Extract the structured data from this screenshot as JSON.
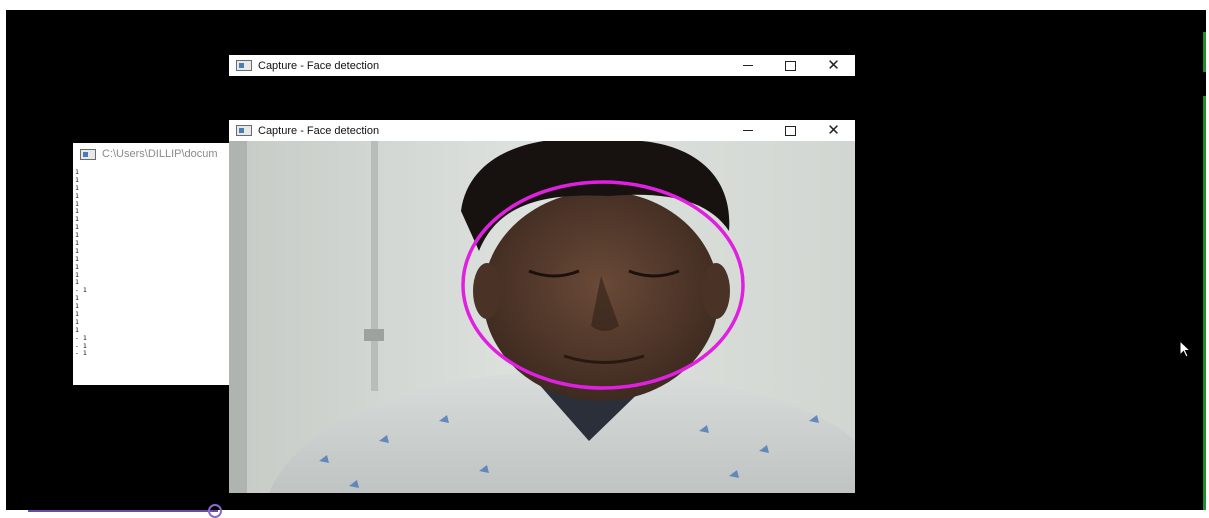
{
  "windows": {
    "capture_back": {
      "title": "Capture - Face detection",
      "minimize": "—",
      "maximize": "☐",
      "close": "✕"
    },
    "capture_front": {
      "title": "Capture - Face detection",
      "minimize": "—",
      "maximize": "☐",
      "close": "✕"
    },
    "console": {
      "title": "C:\\Users\\DILLIP\\docum",
      "lines": [
        "1",
        "1",
        "1",
        "1",
        "1",
        "1",
        "1",
        "1",
        "1",
        "1",
        "1",
        "1",
        "1",
        "1",
        "1",
        "- 1",
        "1",
        "1",
        "1",
        "1",
        "1",
        "- 1",
        "- 1",
        "- 1"
      ]
    }
  },
  "detection": {
    "shape": "ellipse",
    "color": "#e020e0"
  },
  "colors": {
    "desktop": "#000000",
    "accent_edge": "#1f8f2a"
  }
}
